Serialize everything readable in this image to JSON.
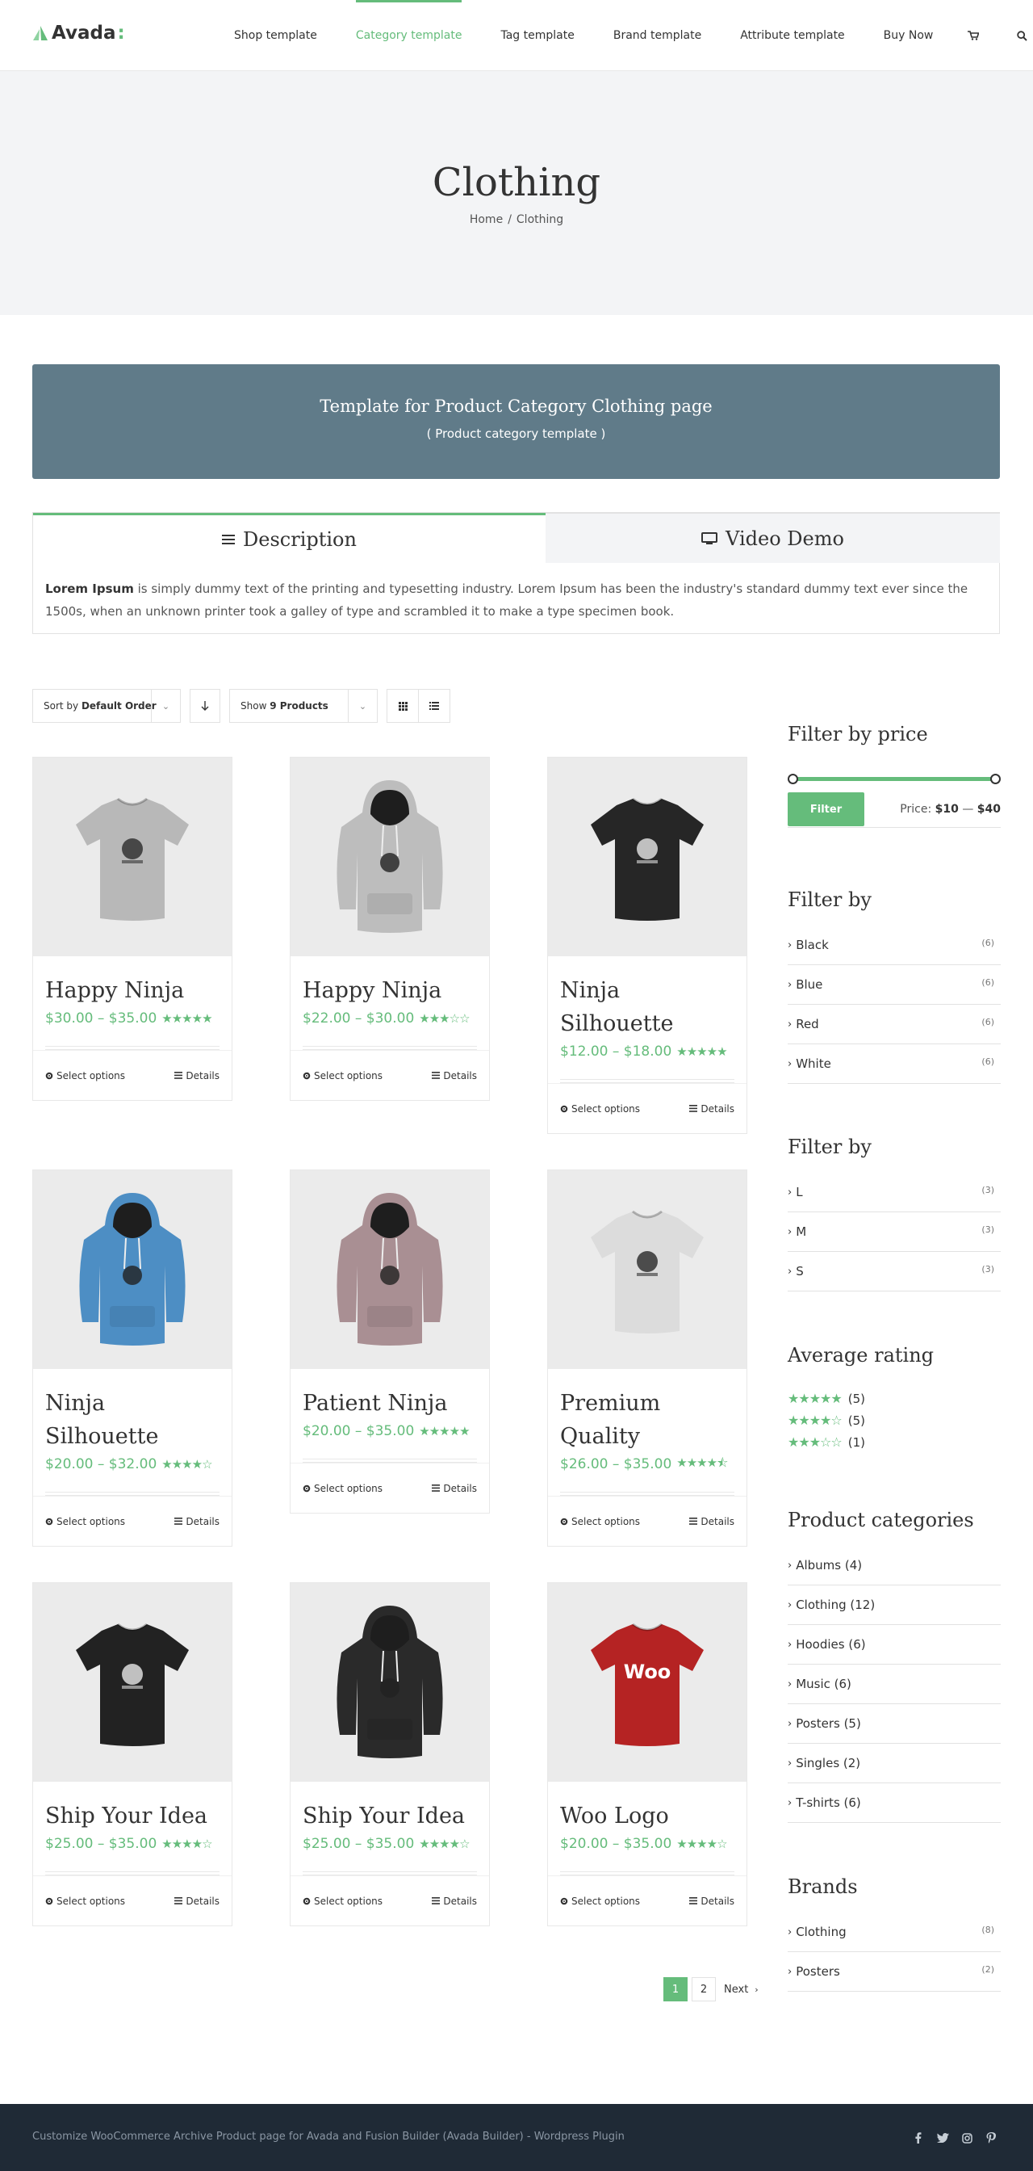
{
  "brand": {
    "name": "Avada",
    "accent": "#65bc7b"
  },
  "nav": {
    "items": [
      "Shop template",
      "Category template",
      "Tag template",
      "Brand template",
      "Attribute template",
      "Buy Now"
    ],
    "active_index": 1
  },
  "page": {
    "title": "Clothing",
    "breadcrumb": {
      "home": "Home",
      "sep": "/",
      "current": "Clothing"
    }
  },
  "banner": {
    "title": "Template for Product Category Clothing page",
    "subtitle": "( Product category template )",
    "color": "#607b89"
  },
  "tabs": {
    "description_label": "Description",
    "video_label": "Video Demo",
    "content_bold": "Lorem Ipsum",
    "content_text": " is simply dummy text of the printing and typesetting industry. Lorem Ipsum has been the industry's standard dummy text ever since the 1500s, when an unknown printer took a galley of type and scrambled it to make a type specimen book."
  },
  "toolbar": {
    "sort_prefix": "Sort by ",
    "sort_value": "Default Order",
    "show_prefix": "Show ",
    "show_value": "9 Products"
  },
  "products": [
    {
      "name": "Happy Ninja",
      "price": "$30.00 – $35.00",
      "rating": 5,
      "shirt": "tee",
      "color": "#b8b8b8"
    },
    {
      "name": "Happy Ninja",
      "price": "$22.00 – $30.00",
      "rating": 3,
      "shirt": "hoodie",
      "color": "#bdbdbd"
    },
    {
      "name": "Ninja Silhouette",
      "price": "$12.00 – $18.00",
      "rating": 5,
      "shirt": "tee",
      "color": "#262626"
    },
    {
      "name": "Ninja Silhouette",
      "price": "$20.00 – $32.00",
      "rating": 4,
      "shirt": "hoodie",
      "color": "#4d8ec4"
    },
    {
      "name": "Patient Ninja",
      "price": "$20.00 – $35.00",
      "rating": 5,
      "shirt": "hoodie",
      "color": "#a98f93"
    },
    {
      "name": "Premium Quality",
      "price": "$26.00 – $35.00",
      "rating": 4.5,
      "shirt": "tee",
      "color": "#dcdcdc"
    },
    {
      "name": "Ship Your Idea",
      "price": "$25.00 – $35.00",
      "rating": 4,
      "shirt": "tee",
      "color": "#222222"
    },
    {
      "name": "Ship Your Idea",
      "price": "$25.00 – $35.00",
      "rating": 4,
      "shirt": "hoodie",
      "color": "#2a2a2a"
    },
    {
      "name": "Woo Logo",
      "price": "$20.00 – $35.00",
      "rating": 4,
      "shirt": "tee",
      "color": "#b52323",
      "logo_text": "Woo"
    }
  ],
  "card_actions": {
    "select": "Select options",
    "details": "Details"
  },
  "sidebar": {
    "price": {
      "title": "Filter by price",
      "button": "Filter",
      "label": "Price:",
      "min": "$10",
      "dash": "—",
      "max": "$40"
    },
    "color_filter": {
      "title": "Filter by",
      "items": [
        {
          "label": "Black",
          "count": "(6)"
        },
        {
          "label": "Blue",
          "count": "(6)"
        },
        {
          "label": "Red",
          "count": "(6)"
        },
        {
          "label": "White",
          "count": "(6)"
        }
      ]
    },
    "size_filter": {
      "title": "Filter by",
      "items": [
        {
          "label": "L",
          "count": "(3)"
        },
        {
          "label": "M",
          "count": "(3)"
        },
        {
          "label": "S",
          "count": "(3)"
        }
      ]
    },
    "rating": {
      "title": "Average rating",
      "rows": [
        {
          "stars": 5,
          "count": "(5)"
        },
        {
          "stars": 4,
          "count": "(5)"
        },
        {
          "stars": 3,
          "count": "(1)"
        }
      ]
    },
    "categories": {
      "title": "Product categories",
      "items": [
        "Albums (4)",
        "Clothing (12)",
        "Hoodies (6)",
        "Music (6)",
        "Posters (5)",
        "Singles (2)",
        "T-shirts (6)"
      ]
    },
    "brands": {
      "title": "Brands",
      "items": [
        {
          "label": "Clothing",
          "count": "(8)"
        },
        {
          "label": "Posters",
          "count": "(2)"
        }
      ]
    }
  },
  "pagination": {
    "pages": [
      "1",
      "2"
    ],
    "current": "1",
    "next": "Next"
  },
  "footer": {
    "text": "Customize WooCommerce Archive Product page for Avada and Fusion Builder (Avada Builder) - Wordpress Plugin",
    "social": [
      "facebook-icon",
      "twitter-icon",
      "instagram-icon",
      "pinterest-icon"
    ]
  }
}
